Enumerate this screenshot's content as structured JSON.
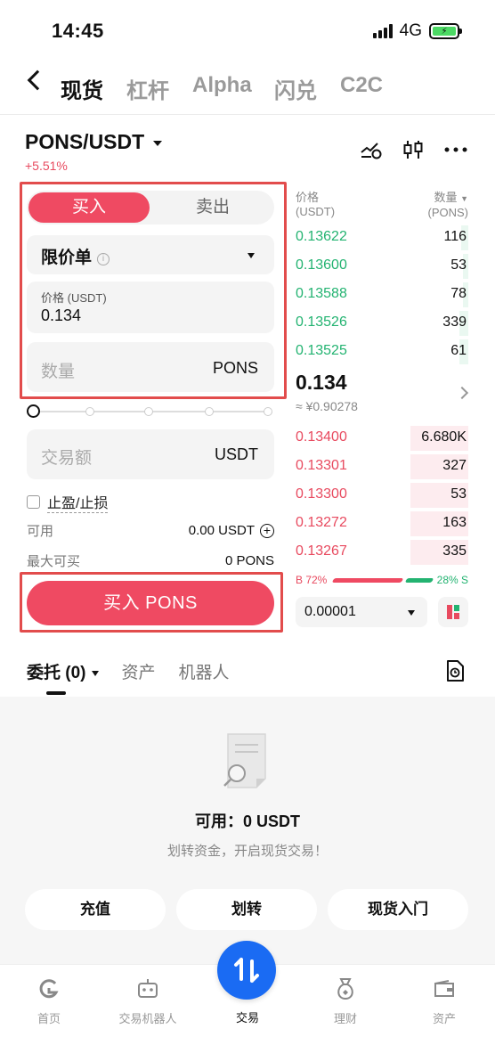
{
  "status": {
    "time": "14:45",
    "network": "4G"
  },
  "nav": {
    "tabs": [
      "现货",
      "杠杆",
      "Alpha",
      "闪兑",
      "C2C"
    ]
  },
  "pair": {
    "symbol": "PONS/USDT",
    "change": "+5.51%"
  },
  "order_form": {
    "buy_tab": "买入",
    "sell_tab": "卖出",
    "order_type": "限价单",
    "price_label": "价格 (USDT)",
    "price_value": "0.134",
    "qty_placeholder": "数量",
    "qty_unit": "PONS",
    "amount_placeholder": "交易额",
    "amount_unit": "USDT",
    "tpsl_label": "止盈/止损",
    "available_label": "可用",
    "available_value": "0.00 USDT",
    "max_buy_label": "最大可买",
    "max_buy_value": "0 PONS",
    "submit_label": "买入 PONS"
  },
  "orderbook": {
    "price_header": "价格",
    "price_unit": "(USDT)",
    "qty_header": "数量",
    "qty_unit": "(PONS)",
    "asks": [
      {
        "price": "0.13622",
        "qty": "116",
        "depth": 0.04
      },
      {
        "price": "0.13600",
        "qty": "53",
        "depth": 0.03
      },
      {
        "price": "0.13588",
        "qty": "78",
        "depth": 0.03
      },
      {
        "price": "0.13526",
        "qty": "339",
        "depth": 0.05
      },
      {
        "price": "0.13525",
        "qty": "61",
        "depth": 0.05
      }
    ],
    "last_price": "0.134",
    "last_fiat": "≈ ¥0.90278",
    "bids": [
      {
        "price": "0.13400",
        "qty": "6.680K",
        "depth": 0.33
      },
      {
        "price": "0.13301",
        "qty": "327",
        "depth": 0.33
      },
      {
        "price": "0.13300",
        "qty": "53",
        "depth": 0.33
      },
      {
        "price": "0.13272",
        "qty": "163",
        "depth": 0.33
      },
      {
        "price": "0.13267",
        "qty": "335",
        "depth": 0.33
      }
    ],
    "buy_ratio": "B 72%",
    "sell_ratio": "28% S",
    "precision": "0.00001"
  },
  "bottom_tabs": {
    "orders": "委托 (0)",
    "assets": "资产",
    "bots": "机器人"
  },
  "empty": {
    "available": "可用：0 USDT",
    "hint": "划转资金，开启现货交易！",
    "actions": [
      "充值",
      "划转",
      "现货入门"
    ]
  },
  "bottom_nav": {
    "items": [
      "首页",
      "交易机器人",
      "交易",
      "理财",
      "资产"
    ]
  },
  "colors": {
    "buy": "#ef4a62",
    "ask_green": "#23b371",
    "accent_blue": "#1a6bf3",
    "highlight_box": "#e24c4c"
  }
}
